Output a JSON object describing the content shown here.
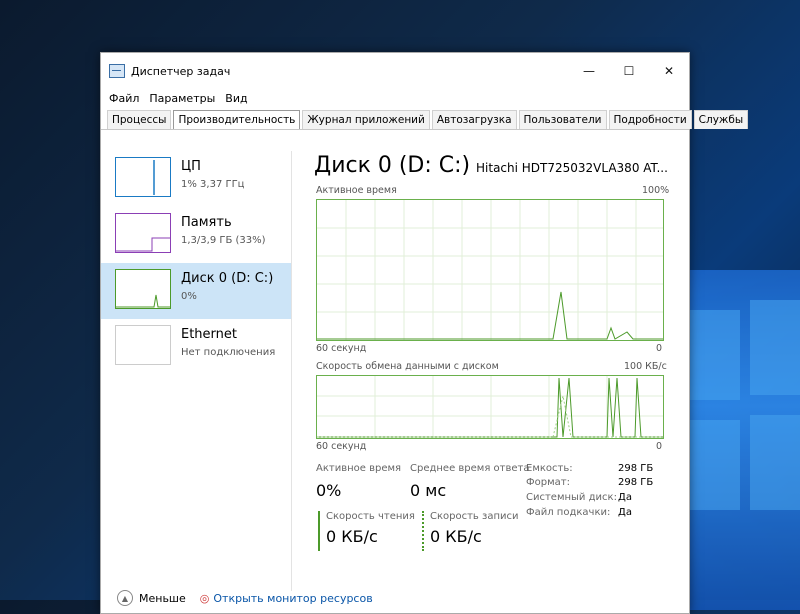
{
  "window": {
    "title": "Диспетчер задач",
    "controls": {
      "minimize": "—",
      "maximize": "☐",
      "close": "✕"
    }
  },
  "menu": [
    "Файл",
    "Параметры",
    "Вид"
  ],
  "tabs": [
    {
      "label": "Процессы"
    },
    {
      "label": "Производительность"
    },
    {
      "label": "Журнал приложений"
    },
    {
      "label": "Автозагрузка"
    },
    {
      "label": "Пользователи"
    },
    {
      "label": "Подробности"
    },
    {
      "label": "Службы"
    }
  ],
  "sidebar": [
    {
      "name": "ЦП",
      "sub": "1% 3,37 ГГц"
    },
    {
      "name": "Память",
      "sub": "1,3/3,9 ГБ (33%)"
    },
    {
      "name": "Диск 0 (D: C:)",
      "sub": "0%"
    },
    {
      "name": "Ethernet",
      "sub": "Нет подключения"
    }
  ],
  "main": {
    "title": "Диск 0 (D: C:)",
    "model": "Hitachi HDT725032VLA380 AT...",
    "graph1": {
      "label": "Активное время",
      "max": "100%",
      "time": "60 секунд",
      "min": "0"
    },
    "graph2": {
      "label": "Скорость обмена данными с диском",
      "max": "100 КБ/с",
      "time": "60 секунд",
      "min": "0"
    },
    "stats": {
      "active_label": "Активное время",
      "active_value": "0%",
      "resp_label": "Среднее время ответа",
      "resp_value": "0 мс",
      "read_label": "Скорость чтения",
      "read_value": "0 КБ/с",
      "write_label": "Скорость записи",
      "write_value": "0 КБ/с"
    },
    "info": [
      {
        "k": "Емкость:",
        "v": "298 ГБ"
      },
      {
        "k": "Формат:",
        "v": "298 ГБ"
      },
      {
        "k": "Системный диск:",
        "v": "Да"
      },
      {
        "k": "Файл подкачки:",
        "v": "Да"
      }
    ]
  },
  "footer": {
    "less": "Меньше",
    "monitor": "Открыть монитор ресурсов"
  }
}
